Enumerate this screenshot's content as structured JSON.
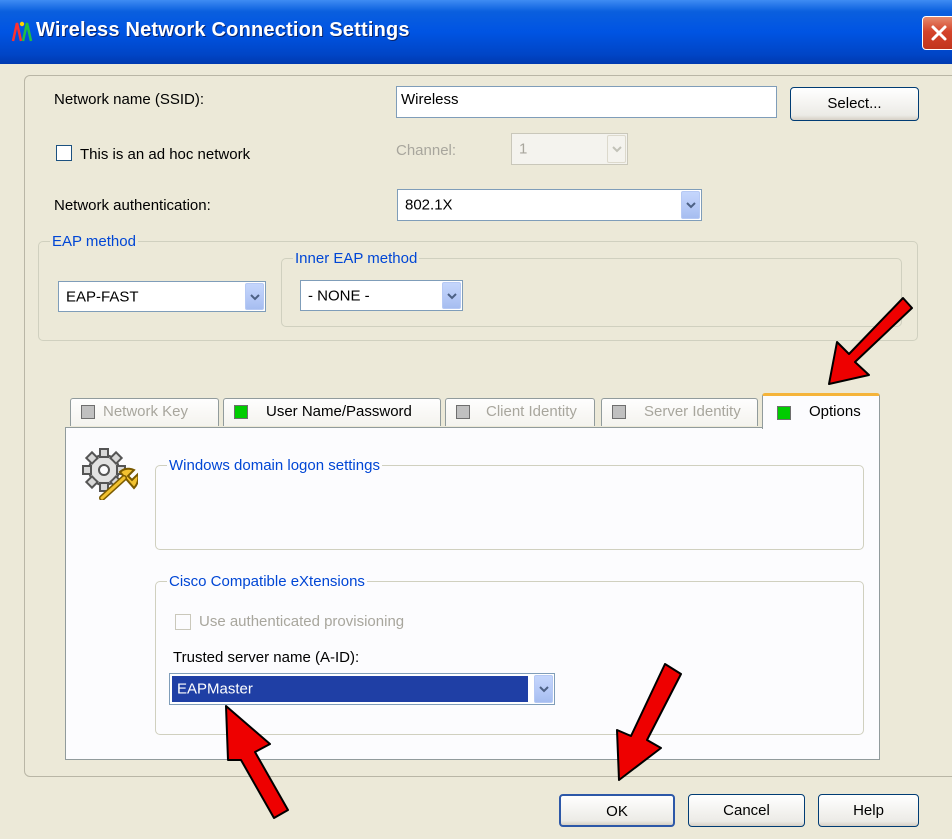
{
  "window": {
    "title": "Wireless Network Connection Settings",
    "close_label": "×"
  },
  "ssid": {
    "label": "Network name (SSID):",
    "value": "Wireless",
    "select_label": "Select..."
  },
  "adhoc": {
    "label": "This is an ad hoc network",
    "checked": false,
    "channel_label": "Channel:",
    "channel_value": "1"
  },
  "auth": {
    "label": "Network authentication:",
    "value": "802.1X"
  },
  "eap": {
    "group_label": "EAP method",
    "value": "EAP-FAST",
    "inner_group_label": "Inner EAP method",
    "inner_value": "- NONE -"
  },
  "tabs": [
    {
      "label": "Network Key",
      "status_color": "#c0c0c0",
      "enabled": false
    },
    {
      "label": "User Name/Password",
      "status_color": "#00cc00",
      "enabled": true
    },
    {
      "label": "Client Identity",
      "status_color": "#c0c0c0",
      "enabled": false
    },
    {
      "label": "Server Identity",
      "status_color": "#c0c0c0",
      "enabled": false
    },
    {
      "label": "Options",
      "status_color": "#00cc00",
      "enabled": true,
      "active": true
    }
  ],
  "options_tab": {
    "icon": "gear-wrench-icon",
    "windows_group_label": "Windows domain logon settings",
    "cisco_group_label": "Cisco Compatible eXtensions",
    "provisioning_label": "Use authenticated provisioning",
    "provisioning_checked": false,
    "trusted_label": "Trusted server name (A-ID):",
    "trusted_value": "EAPMaster"
  },
  "buttons": {
    "ok": "OK",
    "cancel": "Cancel",
    "help": "Help"
  },
  "colors": {
    "title_bar": "#0054e3",
    "dialog_bg": "#ece9d8",
    "group_label": "#0046d5",
    "status_green": "#00cc00",
    "highlight": "#1f3fa5",
    "arrow_red": "#ee0000"
  }
}
